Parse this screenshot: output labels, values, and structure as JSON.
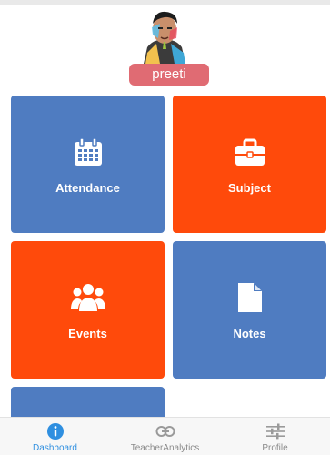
{
  "user": {
    "name": "preeti"
  },
  "tiles": [
    {
      "label": "Attendance",
      "icon": "calendar-icon",
      "color": "#4f7cc1"
    },
    {
      "label": "Subject",
      "icon": "briefcase-icon",
      "color": "#ff4a0b"
    },
    {
      "label": "Events",
      "icon": "users-icon",
      "color": "#ff4a0b"
    },
    {
      "label": "Notes",
      "icon": "document-icon",
      "color": "#4f7cc1"
    }
  ],
  "bottom_nav": [
    {
      "label": "Dashboard",
      "icon": "info-icon",
      "active": true
    },
    {
      "label": "TeacherAnalytics",
      "icon": "link-icon",
      "active": false
    },
    {
      "label": "Profile",
      "icon": "sliders-icon",
      "active": false
    }
  ],
  "colors": {
    "accent": "#2f8fe0",
    "tile_blue": "#4f7cc1",
    "tile_orange": "#ff4a0b",
    "name_badge": "#e06b73"
  }
}
